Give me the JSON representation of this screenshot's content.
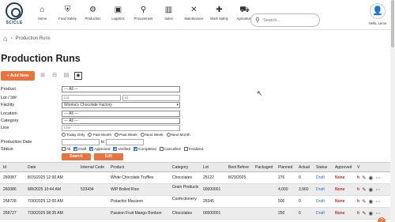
{
  "app": {
    "logo_text": "SCICLE"
  },
  "nav": [
    {
      "label": "Home",
      "icon": "home-icon",
      "glyph": "⌂"
    },
    {
      "label": "Food Safety",
      "icon": "shield-icon",
      "glyph": "⛨"
    },
    {
      "label": "Production",
      "icon": "gears-icon",
      "glyph": "⚙"
    },
    {
      "label": "Logistics",
      "icon": "box-icon",
      "glyph": "▣"
    },
    {
      "label": "Procurement",
      "icon": "network-icon",
      "glyph": "⚲"
    },
    {
      "label": "Sales",
      "icon": "bar-chart-icon",
      "glyph": "▥"
    },
    {
      "label": "Maintenance",
      "icon": "tools-icon",
      "glyph": "✕"
    },
    {
      "label": "Work Safety",
      "icon": "plus-icon",
      "glyph": "✚"
    },
    {
      "label": "Agriculture",
      "icon": "tractor-icon",
      "glyph": "⛟"
    }
  ],
  "search": {
    "placeholder": "Search..."
  },
  "user": {
    "name": "Hello, Leron"
  },
  "breadcrumb": {
    "current": "Production Runs"
  },
  "page": {
    "title": "Production Runs"
  },
  "toolbar": {
    "add_label": "+ Add New"
  },
  "filters": {
    "product": {
      "label": "Product",
      "value": "--- All ---"
    },
    "lot_id": {
      "label": "Lot / Id#",
      "lot_placeholder": "Lot",
      "id_placeholder": "Id"
    },
    "facility": {
      "label": "Facility",
      "value": "Wonka's Chocolate Factory"
    },
    "location": {
      "label": "Location",
      "value": "--- All ---"
    },
    "category": {
      "label": "Category",
      "value": "--- All ---"
    },
    "line": {
      "label": "Line",
      "placeholder": "Line"
    },
    "date_options": [
      "Today Only",
      "Past Month",
      "Past Week",
      "Next Week",
      "Next Month"
    ],
    "production_date": {
      "label": "Production Date",
      "to": "to"
    },
    "status": {
      "label": "Status",
      "options": [
        {
          "label": "All",
          "checked": false
        },
        {
          "label": "Draft",
          "checked": true
        },
        {
          "label": "Approved",
          "checked": true
        },
        {
          "label": "Verified",
          "checked": true
        },
        {
          "label": "Completed",
          "checked": true
        },
        {
          "label": "Cancelled",
          "checked": false
        },
        {
          "label": "Finalized",
          "checked": false
        }
      ]
    },
    "search_button": "Search",
    "edit_button": "Edit"
  },
  "table": {
    "headers": [
      "Id",
      "Date",
      "Internal Code",
      "Product",
      "Category",
      "Lot",
      "Best Before",
      "Packaged",
      "Planned",
      "Actual",
      "Status",
      "Approved",
      "V"
    ],
    "rows": [
      {
        "id": "260087",
        "date": "8/15/2025 12:00 AM",
        "code": "",
        "product": "White Chocolate Truffles",
        "category": "Chocolates",
        "lot": "25122",
        "best_before": "8/29/2025",
        "packaged": "",
        "planned": "276",
        "actual": "0",
        "status": "Draft",
        "approved": "None"
      },
      {
        "id": "260086",
        "date": "8/8/2025 10:44 AM",
        "code": "533434",
        "product": "WIP Boiled Rice",
        "category": "Grain Products",
        "lot": "00000001",
        "best_before": "",
        "packaged": "",
        "planned": "4,000",
        "actual": "3,960",
        "status": "Draft",
        "approved": "None"
      },
      {
        "id": "258728",
        "date": "7/30/2025 12:00 AM",
        "code": "",
        "product": "Pistachio Macaron",
        "category": "Confectionery",
        "lot": "25345",
        "best_before": "",
        "packaged": "",
        "planned": "500",
        "actual": "0",
        "status": "Draft",
        "approved": "None"
      },
      {
        "id": "258727",
        "date": "7/30/2025 08:35 AM",
        "code": "",
        "product": "Passion Fruit Mango Bonbon",
        "category": "Chocolates",
        "lot": "00000001",
        "best_before": "",
        "packaged": "",
        "planned": "250",
        "actual": "0",
        "status": "Draft",
        "approved": "None"
      }
    ]
  },
  "colors": {
    "accent": "#e8733f",
    "status_link": "#2a6fb8",
    "none_red": "#c62828"
  }
}
